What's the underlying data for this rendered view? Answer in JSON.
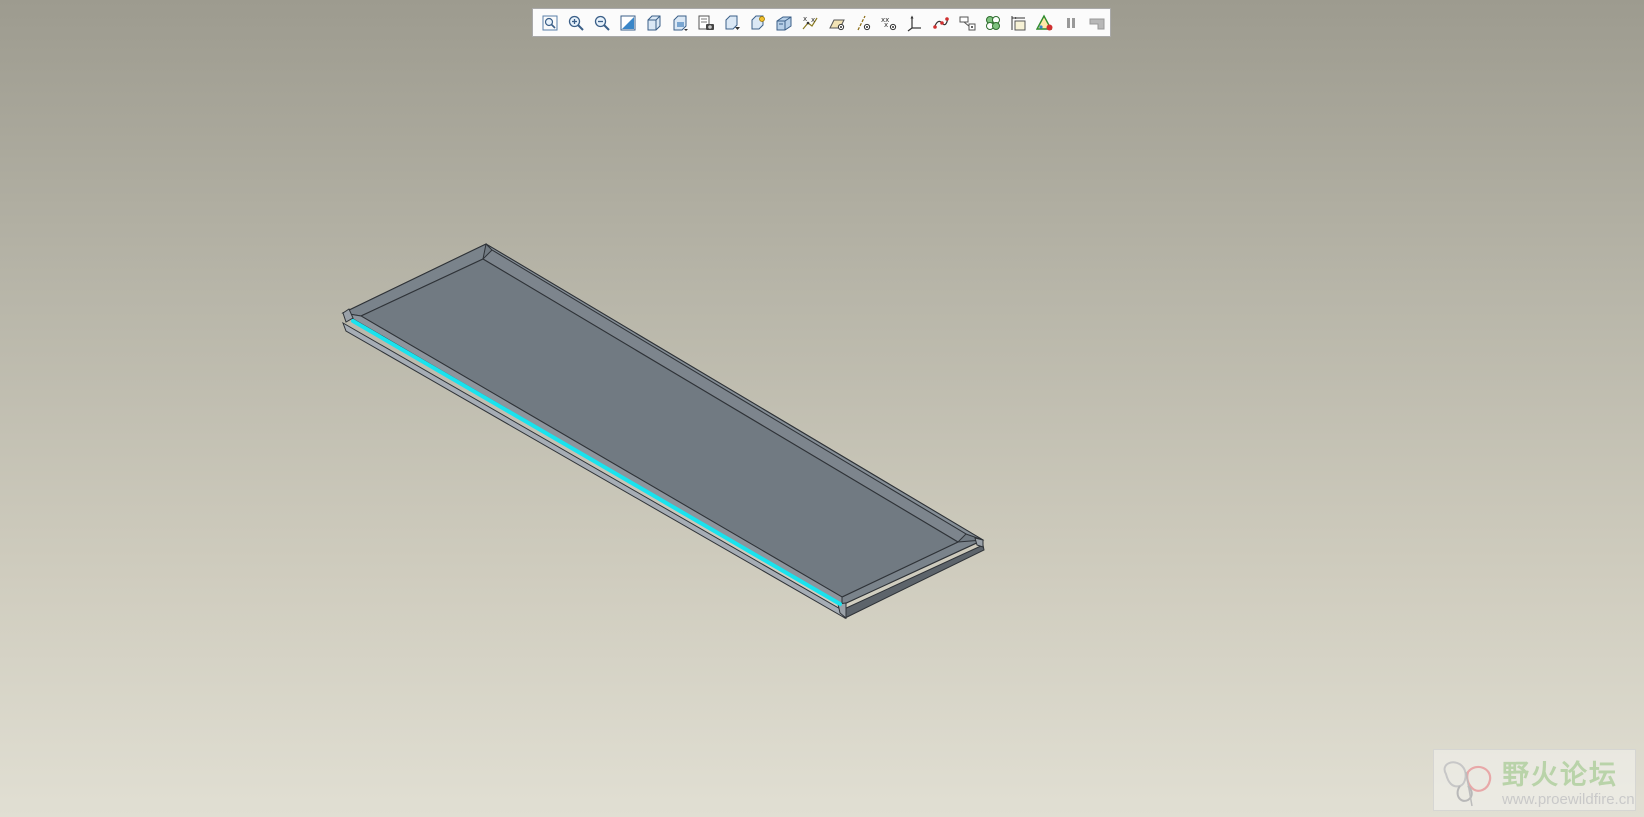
{
  "viewport": {
    "background_top": "#9d9b8f",
    "background_bottom": "#e1dfd3"
  },
  "toolbar": {
    "items": [
      {
        "name": "refit-icon",
        "tooltip": ""
      },
      {
        "name": "zoom-in-icon",
        "tooltip": ""
      },
      {
        "name": "zoom-out-icon",
        "tooltip": ""
      },
      {
        "name": "repaint-icon",
        "tooltip": ""
      },
      {
        "name": "reorient-icon",
        "tooltip": ""
      },
      {
        "name": "saved-orientations-icon",
        "tooltip": ""
      },
      {
        "name": "view-manager-icon",
        "tooltip": ""
      },
      {
        "name": "display-style-icon",
        "tooltip": ""
      },
      {
        "name": "spin-center-icon",
        "tooltip": ""
      },
      {
        "name": "perspective-view-icon",
        "tooltip": ""
      },
      {
        "name": "datum-display-filters-icon",
        "tooltip": ""
      },
      {
        "name": "plane-display-icon",
        "tooltip": ""
      },
      {
        "name": "axis-display-icon",
        "tooltip": ""
      },
      {
        "name": "point-display-icon",
        "tooltip": ""
      },
      {
        "name": "csys-display-icon",
        "tooltip": ""
      },
      {
        "name": "curve-display-icon",
        "tooltip": ""
      },
      {
        "name": "annotation-display-icon",
        "tooltip": ""
      },
      {
        "name": "appearance-gallery-icon",
        "tooltip": ""
      },
      {
        "name": "dimension-display-icon",
        "tooltip": ""
      },
      {
        "name": "model-check-icon",
        "tooltip": ""
      },
      {
        "name": "pause-icon",
        "tooltip": ""
      },
      {
        "name": "disabled-tool-icon",
        "tooltip": ""
      }
    ]
  },
  "model": {
    "face_color": "#717a82",
    "edge_color": "#2f3338",
    "highlight_color": "#19e3ee"
  },
  "watermark": {
    "title": "野火论坛",
    "url": "www.proewildfire.cn"
  }
}
